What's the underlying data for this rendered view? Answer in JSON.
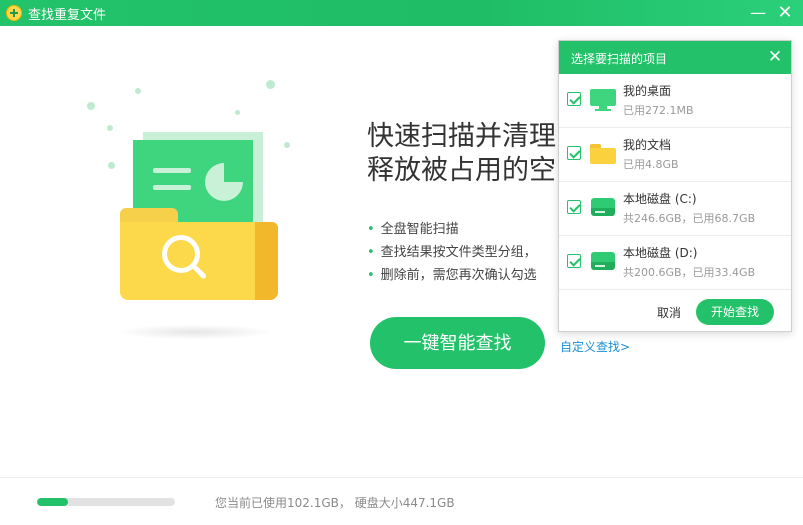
{
  "window": {
    "title": "查找重复文件",
    "minimize_glyph": "—",
    "close_glyph": "✕",
    "logo_icon": "plus-badge-icon"
  },
  "main": {
    "headline_line1": "快速扫描并清理重复文件",
    "headline_line2": "释放被占用的空间",
    "bullets": [
      "全盘智能扫描",
      "查找结果按文件类型分组，",
      "删除前，需您再次确认勾选"
    ],
    "primary_button": "一键智能查找",
    "custom_link": "自定义查找>"
  },
  "status": {
    "disk_text": "您当前已使用102.1GB，  硬盘大小447.1GB",
    "used_fraction": 0.228
  },
  "popup": {
    "title": "选择要扫描的项目",
    "close_glyph": "✕",
    "items": [
      {
        "name": "我的桌面",
        "detail": "已用272.1MB",
        "icon": "monitor-icon",
        "checked": true
      },
      {
        "name": "我的文档",
        "detail": "已用4.8GB",
        "icon": "folder-icon",
        "checked": true
      },
      {
        "name": "本地磁盘 (C:)",
        "detail": "共246.6GB，已用68.7GB",
        "icon": "disk-icon",
        "checked": true
      },
      {
        "name": "本地磁盘 (D:)",
        "detail": "共200.6GB，已用33.4GB",
        "icon": "disk-icon",
        "checked": true
      }
    ],
    "cancel_label": "取消",
    "start_label": "开始查找"
  },
  "colors": {
    "accent": "#23c26a",
    "link": "#1a8fd6",
    "folder": "#fbd94a"
  }
}
